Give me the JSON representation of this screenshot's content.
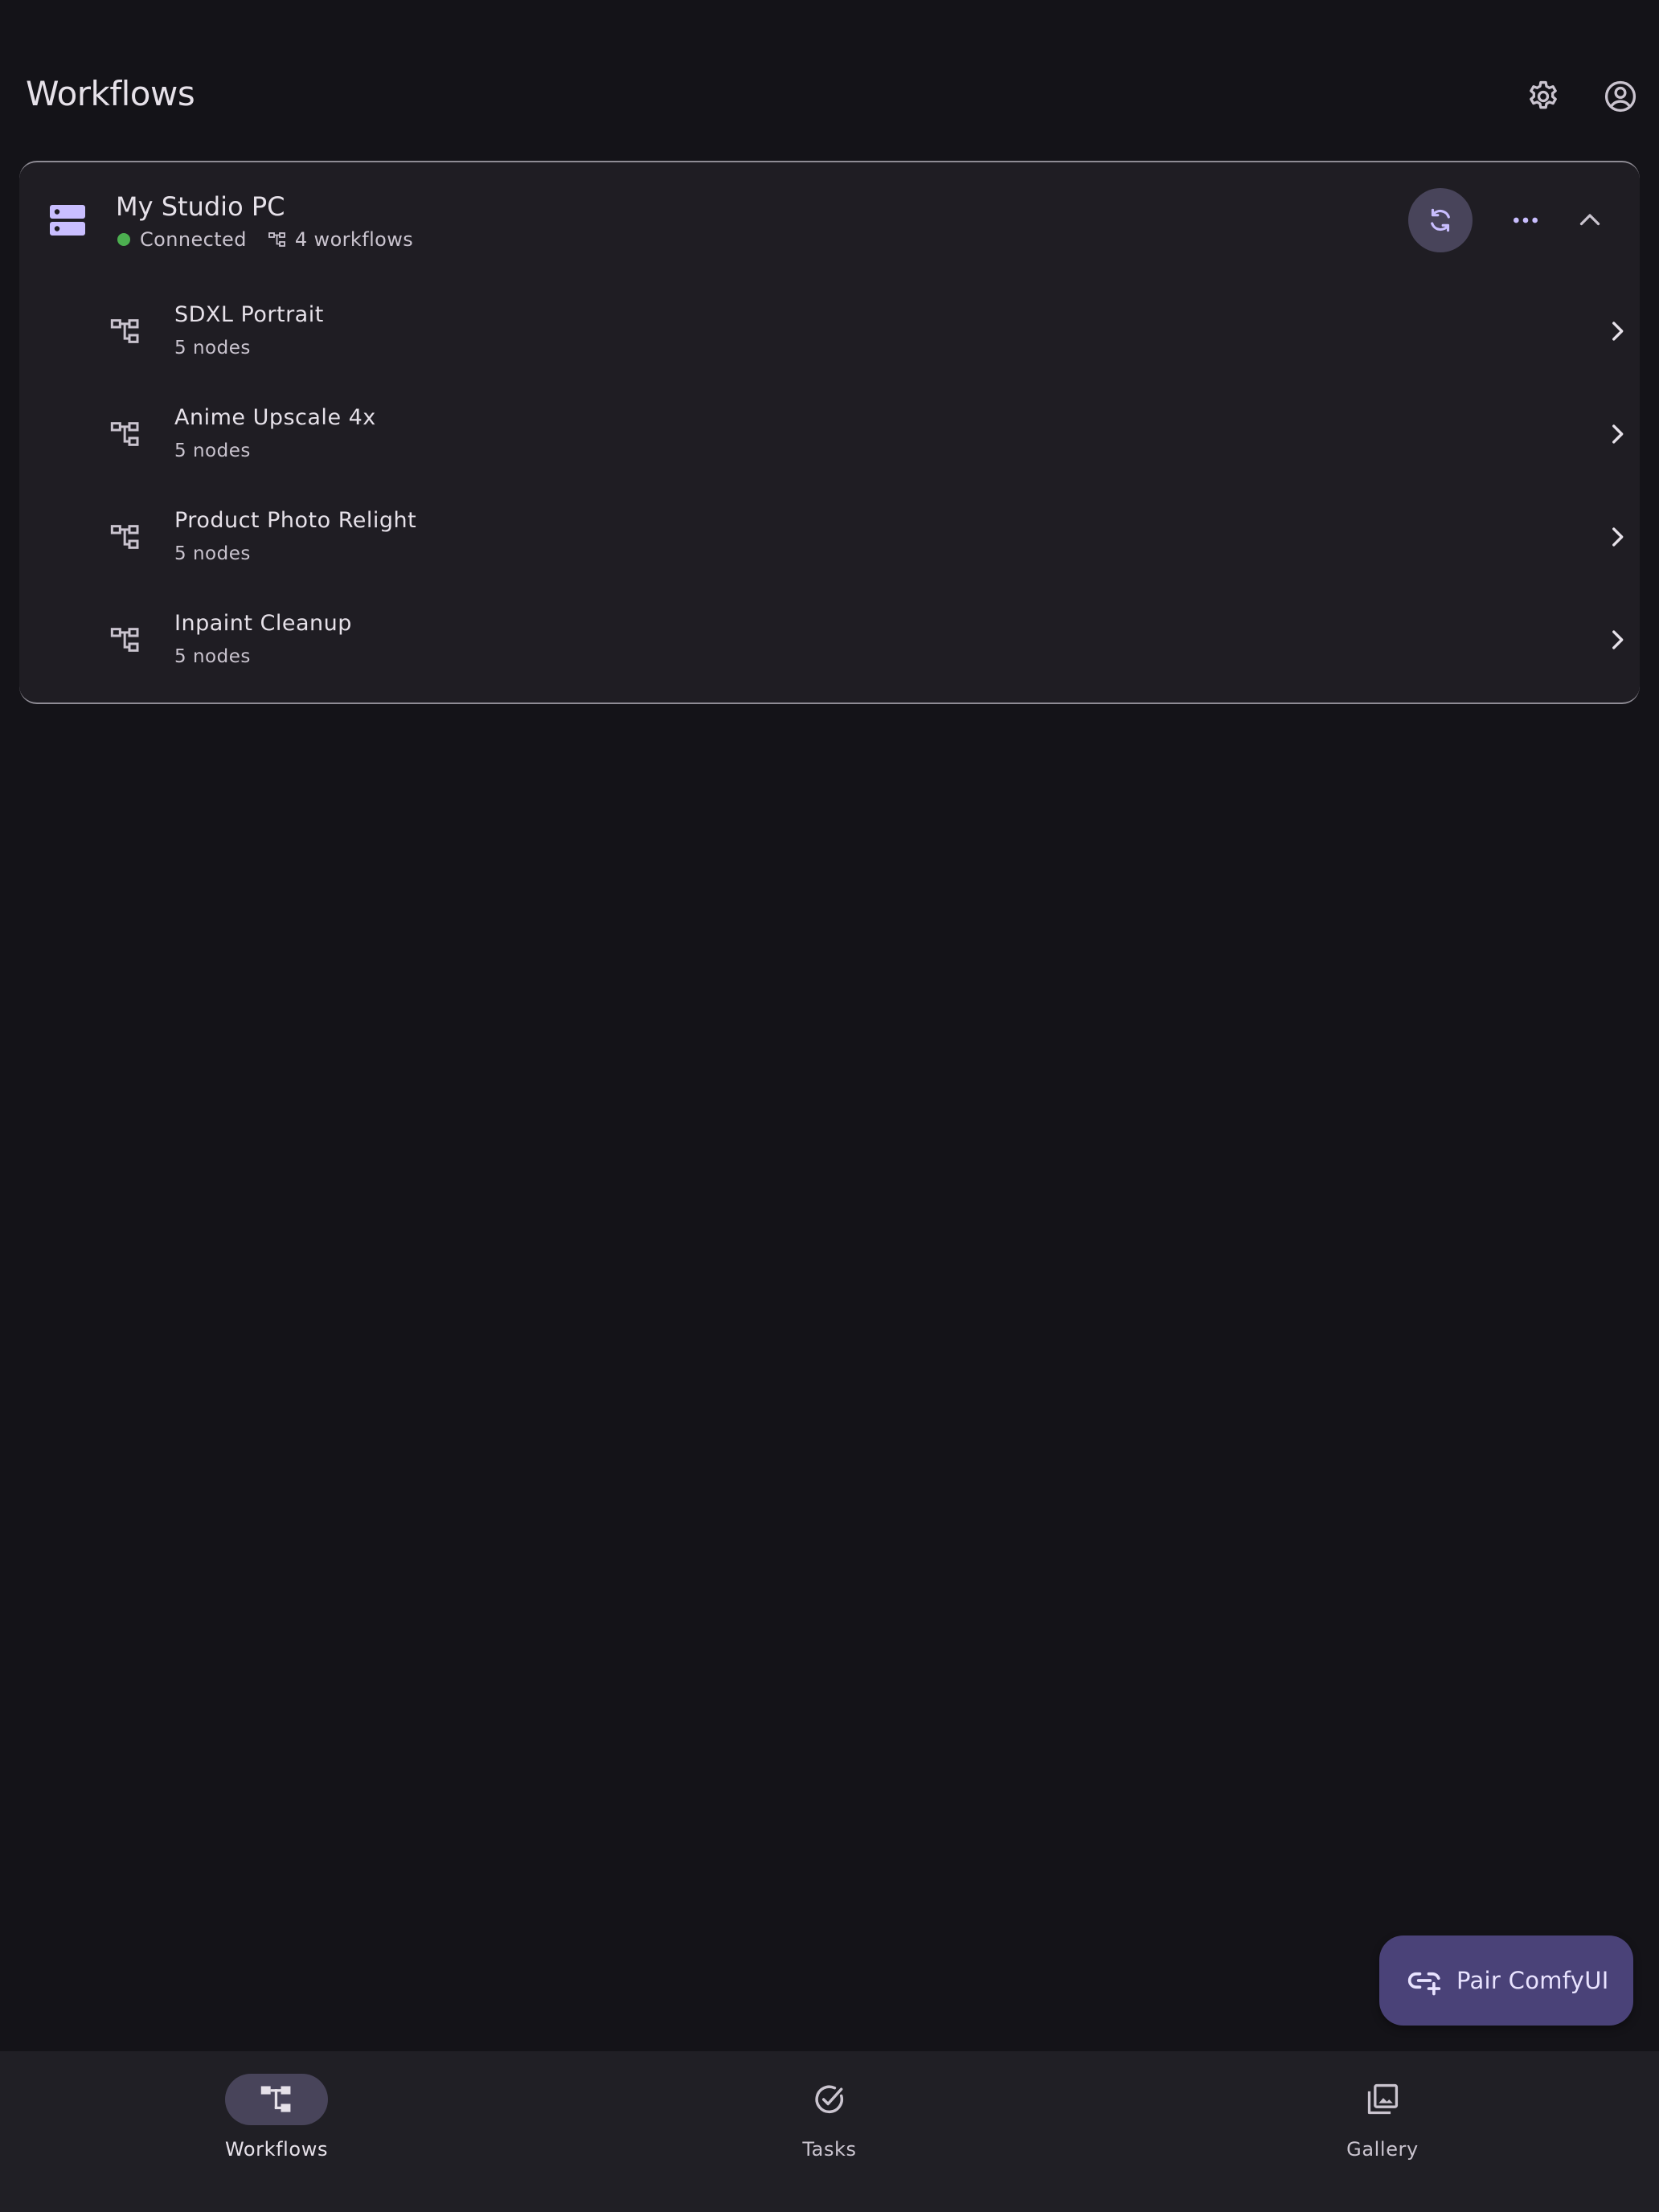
{
  "header": {
    "title": "Workflows",
    "settings_icon": "gear-icon",
    "account_icon": "account-circle-icon"
  },
  "server": {
    "name": "My Studio PC",
    "status": "Connected",
    "status_color": "#4caf50",
    "workflow_count": "4 workflows",
    "icon": "server-icon",
    "actions": [
      "refresh-icon",
      "more-horizontal-icon",
      "chevron-up-icon"
    ],
    "workflows": [
      {
        "name": "SDXL Portrait",
        "nodes": "5 nodes"
      },
      {
        "name": "Anime Upscale 4x",
        "nodes": "5 nodes"
      },
      {
        "name": "Product Photo Relight",
        "nodes": "5 nodes"
      },
      {
        "name": "Inpaint Cleanup",
        "nodes": "5 nodes"
      }
    ]
  },
  "fab": {
    "label": "Pair ComfyUI",
    "icon": "add-link-icon"
  },
  "bottom_nav": {
    "items": [
      {
        "label": "Workflows",
        "icon": "workflow-icon",
        "selected": true
      },
      {
        "label": "Tasks",
        "icon": "check-circle-icon",
        "selected": false
      },
      {
        "label": "Gallery",
        "icon": "gallery-icon",
        "selected": false
      }
    ]
  },
  "colors": {
    "background": "#141318",
    "card": "#1f1d23",
    "accent": "#c9beff",
    "fab": "#4a4278",
    "nav_indicator": "#48445a"
  }
}
